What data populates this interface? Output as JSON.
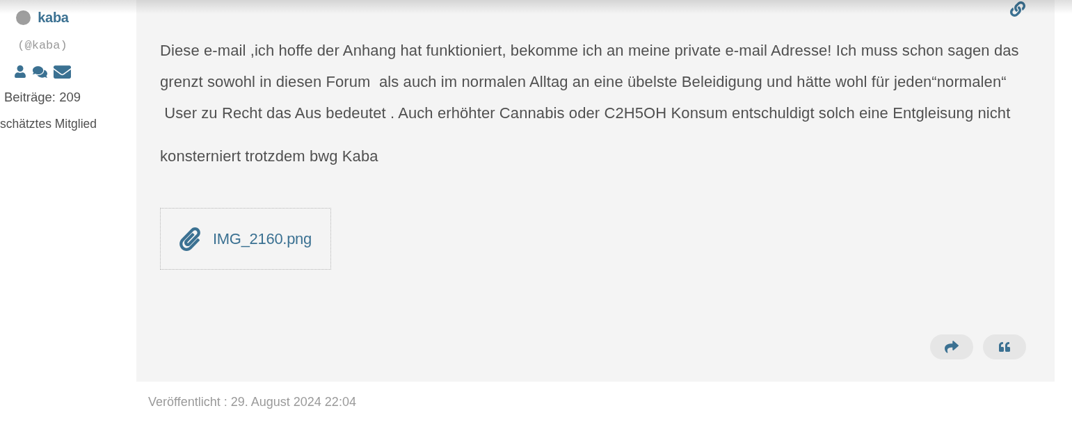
{
  "user": {
    "name": "kaba",
    "online": false,
    "handle": "(@kaba)",
    "posts": "Beiträge: 209",
    "rank": "schätztes Mitglied"
  },
  "post": {
    "paragraphs": [
      {
        "lines": [
          "Diese e-mail ,ich hoffe der Anhang hat funktioniert, bekomme ich an meine private e-mail Adresse! Ich muss schon sagen das",
          "grenzt sowohl in diesen Forum  als auch im normalen Alltag an eine übelste Beleidigung und hätte wohl für jeden“normalen“",
          " User zu Recht das Aus bedeutet . Auch erhöhter Cannabis oder C2H5OH Konsum entschuldigt solch eine Entgleisung nicht"
        ]
      },
      {
        "lines": [
          "konsterniert trotzdem bwg Kaba"
        ]
      }
    ],
    "attachments": [
      {
        "filename": "IMG_2160.png"
      }
    ],
    "actions": [
      {
        "kind": "share"
      },
      {
        "kind": "quote"
      }
    ]
  },
  "published": "Veröffentlicht : 29. August 2024 22:04"
}
